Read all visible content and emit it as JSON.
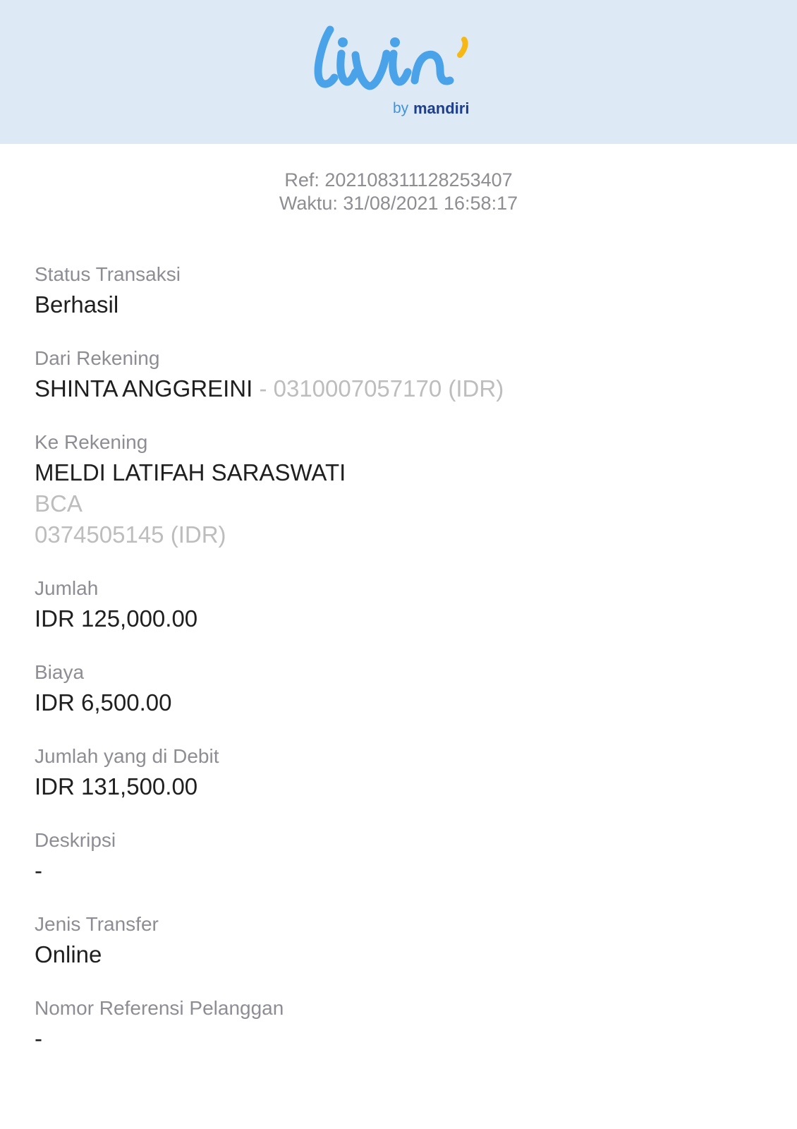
{
  "brand": {
    "logo_text": "livin'",
    "by": "by",
    "name": "mandiri",
    "colors": {
      "header_bg": "#dde9f5",
      "logo_blue": "#4aa3e8",
      "accent_yellow": "#f5b817",
      "brand_navy": "#1d3f8c"
    }
  },
  "meta": {
    "ref": "Ref: 202108311128253407",
    "time": "Waktu: 31/08/2021 16:58:17"
  },
  "fields": {
    "status": {
      "label": "Status Transaksi",
      "value": "Berhasil"
    },
    "from": {
      "label": "Dari Rekening",
      "name": "SHINTA ANGGREINI",
      "separator": " - ",
      "account": "0310007057170 (IDR)"
    },
    "to": {
      "label": "Ke Rekening",
      "name": "MELDI LATIFAH SARASWATI",
      "bank": "BCA",
      "account": "0374505145 (IDR)"
    },
    "amount": {
      "label": "Jumlah",
      "value": "IDR 125,000.00"
    },
    "fee": {
      "label": "Biaya",
      "value": "IDR 6,500.00"
    },
    "debited": {
      "label": "Jumlah yang di Debit",
      "value": "IDR 131,500.00"
    },
    "description": {
      "label": "Deskripsi",
      "value": "-"
    },
    "transfer_type": {
      "label": "Jenis Transfer",
      "value": "Online"
    },
    "customer_ref": {
      "label": "Nomor Referensi Pelanggan",
      "value": "-"
    }
  }
}
